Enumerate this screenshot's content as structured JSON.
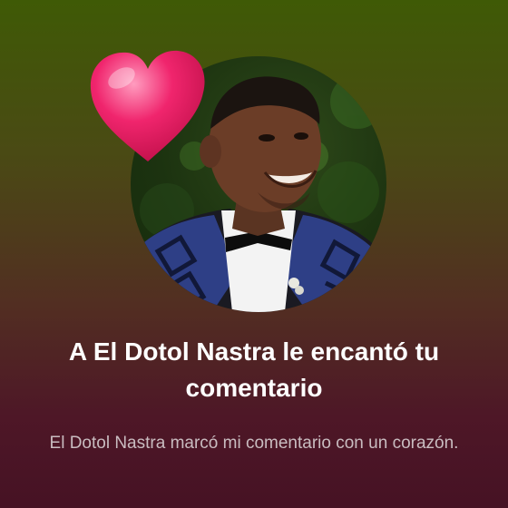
{
  "notification": {
    "icon": "heart-icon",
    "title": "A El Dotol Nastra le encantó tu comentario",
    "description": "El Dotol Nastra marcó mi comentario con un corazón.",
    "avatar_alt": "El Dotol Nastra"
  },
  "colors": {
    "gradient_top": "#3f5a06",
    "gradient_bottom": "#461224",
    "heart": "#f0256d",
    "title_text": "#ffffff",
    "description_text": "#c9bcc0"
  }
}
